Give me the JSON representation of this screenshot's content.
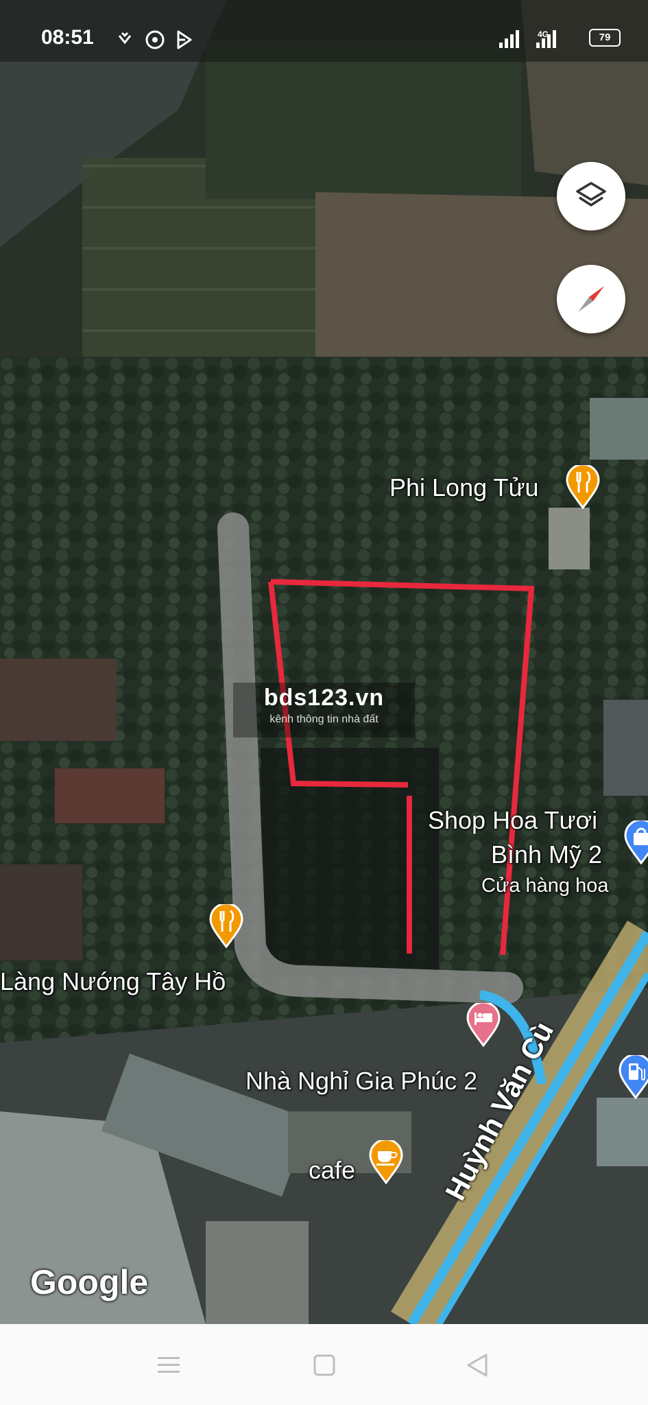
{
  "status_bar": {
    "time": "08:51",
    "network": "4G",
    "battery": "79"
  },
  "map": {
    "controls": {
      "layers_icon": "layers-icon",
      "compass_icon": "compass-icon"
    },
    "places": [
      {
        "id": "phi-long",
        "name": "Phi Long Tửu",
        "icon": "restaurant-icon",
        "color": "#F29900"
      },
      {
        "id": "shop-hoa",
        "name_line1": "Shop Hoa Tươi",
        "name_line2": "Bình Mỹ 2",
        "category": "Cửa hàng hoa",
        "icon": "shopping-bag-icon",
        "color": "#4285F4"
      },
      {
        "id": "lang-nuong",
        "name": "Làng Nướng Tây Hồ",
        "icon": "restaurant-icon",
        "color": "#F29900"
      },
      {
        "id": "nha-nghi",
        "name": "Nhà Nghỉ Gia Phúc 2",
        "icon": "hotel-icon",
        "color": "#E7708A"
      },
      {
        "id": "cafe",
        "name": "cafe",
        "icon": "cafe-icon",
        "color": "#F29900"
      }
    ],
    "road_label": "Huỳnh Văn Cù",
    "watermark": {
      "title": "bds123.vn",
      "subtitle": "kênh thông tin nhà đất"
    },
    "attribution": "Google",
    "boundary_color": "#E8283C"
  },
  "navbar": {
    "menu_icon": "menu-icon",
    "home_icon": "home-square-icon",
    "back_icon": "back-icon"
  }
}
